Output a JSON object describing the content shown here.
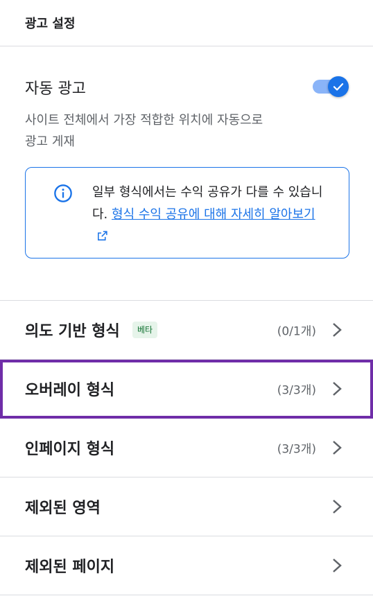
{
  "header": {
    "title": "광고 설정"
  },
  "auto_ads": {
    "title": "자동 광고",
    "toggle_on": true,
    "description": "사이트 전체에서 가장 적합한 위치에 자동으로 광고 게재"
  },
  "info": {
    "text": "일부 형식에서는 수익 공유가 다를 수 있습니다. ",
    "link_text": "형식 수익 공유에 대해 자세히 알아보기"
  },
  "rows": [
    {
      "label": "의도 기반 형식",
      "badge": "베타",
      "count": "(0/1개)"
    },
    {
      "label": "오버레이 형식",
      "count": "(3/3개)"
    },
    {
      "label": "인페이지 형식",
      "count": "(3/3개)"
    },
    {
      "label": "제외된 영역",
      "count": ""
    },
    {
      "label": "제외된 페이지",
      "count": ""
    }
  ],
  "colors": {
    "accent": "#1a73e8",
    "highlight": "#6f2da8",
    "badge_bg": "#e6f4ea",
    "badge_text": "#137333"
  },
  "icons": {
    "info": "info-icon",
    "external": "external-link-icon",
    "chevron": "chevron-right-icon",
    "check": "check-icon"
  }
}
